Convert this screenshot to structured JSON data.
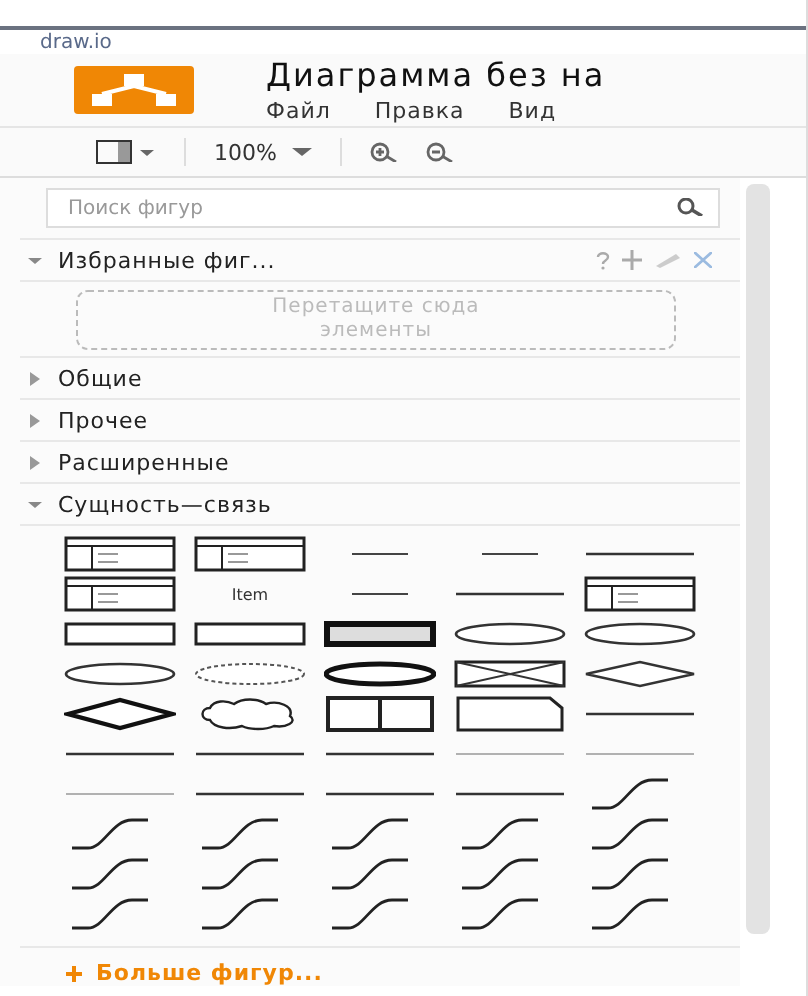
{
  "browser_tab": {
    "title": "draw.io"
  },
  "header": {
    "title": "Диаграмма без на",
    "menu": [
      "Файл",
      "Правка",
      "Вид"
    ]
  },
  "toolbar": {
    "zoom": "100%"
  },
  "sidebar": {
    "search": {
      "placeholder": "Поиск фигур"
    },
    "sections": [
      {
        "title": "Избранные фиг...",
        "expanded": true,
        "kind": "favorites",
        "drop_hint": "Перетащите сюда элементы"
      },
      {
        "title": "Общие",
        "expanded": false,
        "kind": "plain"
      },
      {
        "title": "Прочее",
        "expanded": false,
        "kind": "plain"
      },
      {
        "title": "Расширенные",
        "expanded": false,
        "kind": "plain"
      },
      {
        "title": "Сущность—связь",
        "expanded": true,
        "kind": "shapes"
      }
    ],
    "shapes": [
      {
        "kind": "table"
      },
      {
        "kind": "table"
      },
      {
        "kind": "dash"
      },
      {
        "kind": "dash"
      },
      {
        "kind": "line"
      },
      {
        "kind": "table"
      },
      {
        "kind": "text",
        "label": "Item"
      },
      {
        "kind": "dash"
      },
      {
        "kind": "line"
      },
      {
        "kind": "table"
      },
      {
        "kind": "rect"
      },
      {
        "kind": "rect"
      },
      {
        "kind": "rect-bold"
      },
      {
        "kind": "ellipse"
      },
      {
        "kind": "ellipse"
      },
      {
        "kind": "ellipse"
      },
      {
        "kind": "ellipse-dashed"
      },
      {
        "kind": "ellipse-bold"
      },
      {
        "kind": "rect-cross"
      },
      {
        "kind": "diamond"
      },
      {
        "kind": "diamond-bold"
      },
      {
        "kind": "cloud"
      },
      {
        "kind": "split"
      },
      {
        "kind": "note"
      },
      {
        "kind": "line"
      },
      {
        "kind": "line"
      },
      {
        "kind": "line"
      },
      {
        "kind": "line"
      },
      {
        "kind": "thin"
      },
      {
        "kind": "thin"
      },
      {
        "kind": "thin"
      },
      {
        "kind": "line"
      },
      {
        "kind": "line"
      },
      {
        "kind": "line"
      },
      {
        "kind": "curve"
      },
      {
        "kind": "curve"
      },
      {
        "kind": "curve"
      },
      {
        "kind": "curve"
      },
      {
        "kind": "curve"
      },
      {
        "kind": "curve"
      },
      {
        "kind": "curve"
      },
      {
        "kind": "curve"
      },
      {
        "kind": "curve"
      },
      {
        "kind": "curve"
      },
      {
        "kind": "curve"
      },
      {
        "kind": "curve"
      },
      {
        "kind": "curve"
      },
      {
        "kind": "curve"
      },
      {
        "kind": "curve"
      },
      {
        "kind": "curve"
      }
    ],
    "more_shapes": "Больше фигур..."
  }
}
